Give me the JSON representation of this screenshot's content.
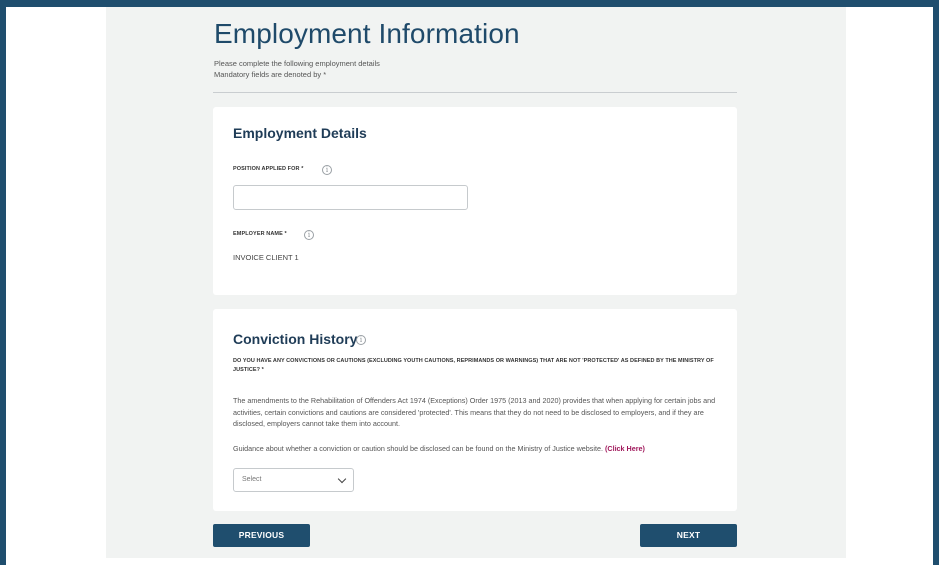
{
  "header": {
    "title": "Employment Information",
    "subtitle": "Please complete the following employment details",
    "mandatory_note": "Mandatory fields are denoted by *"
  },
  "employment_details": {
    "title": "Employment Details",
    "position_label": "POSITION APPLIED FOR *",
    "position_value": "",
    "employer_label": "EMPLOYER NAME *",
    "employer_value": "INVOICE CLIENT 1"
  },
  "conviction_history": {
    "title": "Conviction History",
    "question": "DO YOU HAVE ANY CONVICTIONS OR CAUTIONS (EXCLUDING YOUTH CAUTIONS, REPRIMANDS OR WARNINGS) THAT ARE NOT 'PROTECTED' AS DEFINED BY THE MINISTRY OF JUSTICE? *",
    "paragraph": "The amendments to the Rehabilitation of Offenders Act 1974 (Exceptions) Order 1975 (2013 and 2020) provides that when applying for certain jobs and activities, certain convictions and cautions are considered 'protected'. This means that they do not need to be disclosed to employers, and if they are disclosed, employers cannot take them into account.",
    "guidance_text": "Guidance about whether a conviction or caution should be disclosed can be found on the Ministry of Justice website.",
    "guidance_link": "(Click Here)",
    "select_value": "Select"
  },
  "navigation": {
    "previous_label": "PREVIOUS",
    "next_label": "NEXT"
  },
  "icons": {
    "info": "info-circle-icon",
    "dropdown": "chevron-down-icon"
  },
  "colors": {
    "primary": "#1f4e6e",
    "heading": "#1f4a6a",
    "link": "#a0185b",
    "page_bg": "#f1f3f2"
  }
}
